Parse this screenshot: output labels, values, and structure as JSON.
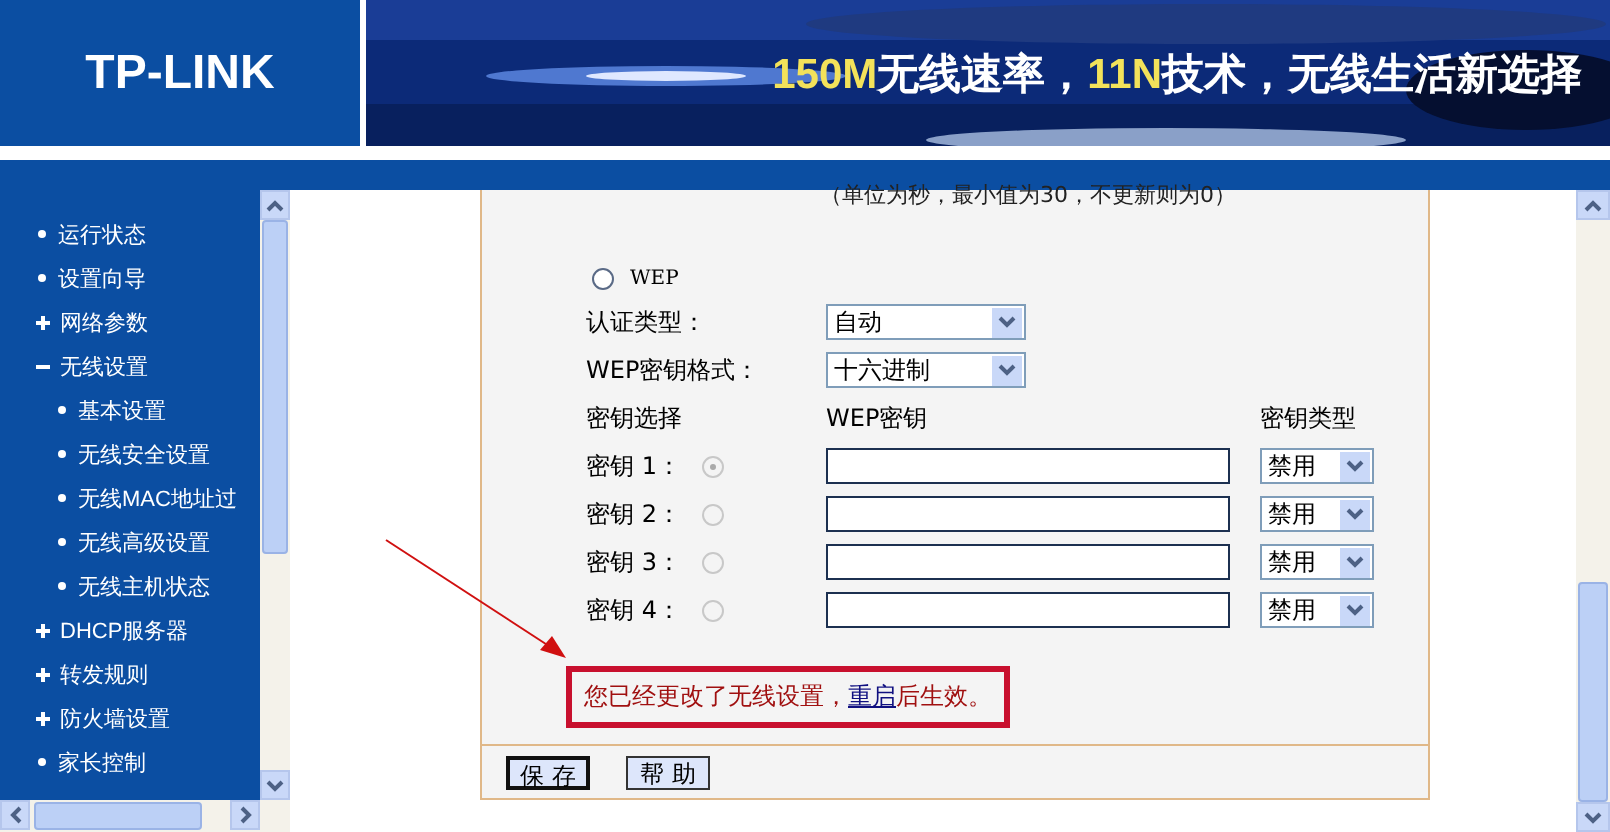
{
  "header": {
    "logo": "TP-LINK",
    "slogan": [
      {
        "text": "150M",
        "highlight": true
      },
      {
        "text": "无线速率，",
        "highlight": false
      },
      {
        "text": "11N",
        "highlight": true
      },
      {
        "text": "技术，无线生活新选择",
        "highlight": false
      }
    ]
  },
  "sidebar": {
    "items": [
      {
        "label": "运行状态",
        "kind": "leaf"
      },
      {
        "label": "设置向导",
        "kind": "leaf"
      },
      {
        "label": "网络参数",
        "kind": "group",
        "expanded": false
      },
      {
        "label": "无线设置",
        "kind": "group",
        "expanded": true,
        "children": [
          {
            "label": "基本设置",
            "kind": "leaf"
          },
          {
            "label": "无线安全设置",
            "kind": "leaf"
          },
          {
            "label": "无线MAC地址过",
            "kind": "leaf"
          },
          {
            "label": "无线高级设置",
            "kind": "leaf"
          },
          {
            "label": "无线主机状态",
            "kind": "leaf"
          }
        ]
      },
      {
        "label": "DHCP服务器",
        "kind": "group",
        "expanded": false
      },
      {
        "label": "转发规则",
        "kind": "group",
        "expanded": false
      },
      {
        "label": "防火墙设置",
        "kind": "group",
        "expanded": false
      },
      {
        "label": "家长控制",
        "kind": "leaf"
      }
    ]
  },
  "form": {
    "hint": "（单位为秒，最小值为30，不更新则为0）",
    "wep_option": {
      "label": "WEP",
      "selected": false
    },
    "auth_type": {
      "label": "认证类型：",
      "value": "自动"
    },
    "key_format": {
      "label": "WEP密钥格式：",
      "value": "十六进制"
    },
    "key_headers": [
      "密钥选择",
      "WEP密钥",
      "密钥类型"
    ],
    "keys": [
      {
        "label": "密钥 1：",
        "selected": true,
        "disabled": true,
        "type": "禁用"
      },
      {
        "label": "密钥 2：",
        "selected": false,
        "disabled": true,
        "type": "禁用"
      },
      {
        "label": "密钥 3：",
        "selected": false,
        "disabled": true,
        "type": "禁用"
      },
      {
        "label": "密钥 4：",
        "selected": false,
        "disabled": true,
        "type": "禁用"
      }
    ],
    "notice": {
      "text": "您已经更改了无线设置，",
      "link": "重启",
      "suffix": "后生效。"
    },
    "buttons": [
      {
        "label": "保 存",
        "focused": true
      },
      {
        "label": "帮 助",
        "focused": false
      }
    ]
  }
}
